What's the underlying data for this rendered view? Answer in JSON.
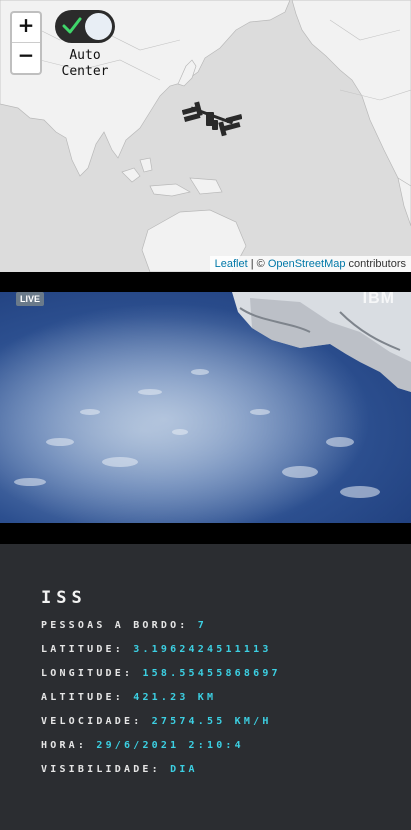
{
  "map": {
    "zoom_in": "+",
    "zoom_out": "−",
    "auto_center": {
      "line1": "Auto",
      "line2": "Center",
      "enabled": true
    },
    "attribution": {
      "leaflet": "Leaflet",
      "separator": " | © ",
      "osm": "OpenStreetMap",
      "suffix": " contributors"
    },
    "icon": "iss-icon"
  },
  "video": {
    "live_label": "LIVE",
    "logo": "IBM"
  },
  "info": {
    "title": "ISS",
    "rows": [
      {
        "label": "PESSOAS A BORDO:",
        "value": "7"
      },
      {
        "label": "LATITUDE:",
        "value": "3.1962424511113"
      },
      {
        "label": "LONGITUDE:",
        "value": "158.55455868697"
      },
      {
        "label": "ALTITUDE:",
        "value": "421.23 KM"
      },
      {
        "label": "VELOCIDADE:",
        "value": "27574.55 KM/H"
      },
      {
        "label": "HORA:",
        "value": "29/6/2021 2:10:4"
      },
      {
        "label": "VISIBILIDADE:",
        "value": "DIA"
      }
    ]
  },
  "colors": {
    "accent": "#3cd0e3",
    "panel_bg": "#2b2d31",
    "map_bg": "#dcdcdc"
  }
}
